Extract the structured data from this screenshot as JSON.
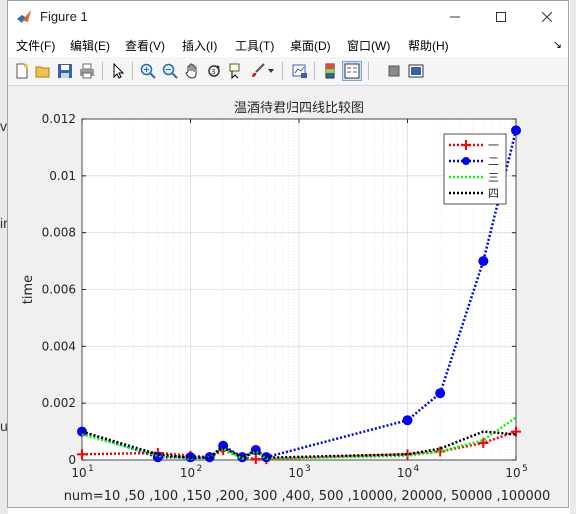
{
  "window": {
    "title": "Figure 1"
  },
  "menu": [
    {
      "label": "文件(F)"
    },
    {
      "label": "编辑(E)"
    },
    {
      "label": "查看(V)"
    },
    {
      "label": "插入(I)"
    },
    {
      "label": "工具(T)"
    },
    {
      "label": "桌面(D)"
    },
    {
      "label": "窗口(W)"
    },
    {
      "label": "帮助(H)"
    }
  ],
  "toolbar_icons": [
    "new-figure-icon",
    "open-file-icon",
    "save-icon",
    "print-icon",
    "edit-plot-icon",
    "zoom-in-icon",
    "zoom-out-icon",
    "pan-icon",
    "rotate-3d-icon",
    "data-cursor-icon",
    "brush-icon",
    "link-plot-icon",
    "colorbar-icon",
    "legend-icon",
    "hide-plot-tools-icon",
    "show-plot-tools-icon"
  ],
  "background_text": [
    "ire",
    "ure",
    "ve"
  ],
  "chart_data": {
    "type": "line",
    "title": "温酒待君归四线比较图",
    "xlabel": "num=10 ,50 ,100 ,150 ,200, 300 ,400, 500 ,10000, 20000, 50000 ,100000",
    "ylabel": "time",
    "xscale": "log",
    "xlim": [
      10,
      100000
    ],
    "ylim": [
      0,
      0.012
    ],
    "yticks": [
      "0",
      "0.002",
      "0.004",
      "0.006",
      "0.008",
      "0.01",
      "0.012"
    ],
    "xtick_bases": [
      "10",
      "10",
      "10",
      "10",
      "10"
    ],
    "xtick_exps": [
      "1",
      "2",
      "3",
      "4",
      "5"
    ],
    "grid": true,
    "legend_position": "top-right",
    "series": [
      {
        "name": "一",
        "color": "#ff0000",
        "marker": "plus",
        "x": [
          10,
          50,
          100,
          150,
          200,
          300,
          400,
          500,
          10000,
          20000,
          50000,
          100000
        ],
        "y": [
          0.0002,
          0.00025,
          0.00015,
          0.0001,
          0.00035,
          0.0001,
          3e-05,
          3e-05,
          0.0002,
          0.0003,
          0.0006,
          0.001
        ]
      },
      {
        "name": "二",
        "color": "#0000ff",
        "marker": "circle",
        "x": [
          10,
          50,
          100,
          150,
          200,
          300,
          400,
          500,
          10000,
          20000,
          50000,
          100000
        ],
        "y": [
          0.001,
          0.0001,
          0.0001,
          0.0001,
          0.0005,
          0.0001,
          0.00035,
          0.0001,
          0.0014,
          0.00235,
          0.007,
          0.0116
        ]
      },
      {
        "name": "三",
        "color": "#00ff00",
        "marker": "none",
        "x": [
          10,
          50,
          100,
          150,
          200,
          300,
          400,
          500,
          10000,
          20000,
          50000,
          100000
        ],
        "y": [
          0.0009,
          0.00015,
          5e-05,
          0.0001,
          0.0004,
          5e-05,
          0.0003,
          5e-05,
          0.00015,
          0.0003,
          0.0007,
          0.0015
        ]
      },
      {
        "name": "四",
        "color": "#000000",
        "marker": "none",
        "x": [
          10,
          50,
          100,
          150,
          200,
          300,
          400,
          500,
          10000,
          20000,
          50000,
          100000
        ],
        "y": [
          0.001,
          0.0002,
          8e-05,
          8e-05,
          0.00045,
          8e-05,
          0.0003,
          8e-05,
          0.0002,
          0.0004,
          0.001,
          0.0009
        ]
      }
    ]
  }
}
